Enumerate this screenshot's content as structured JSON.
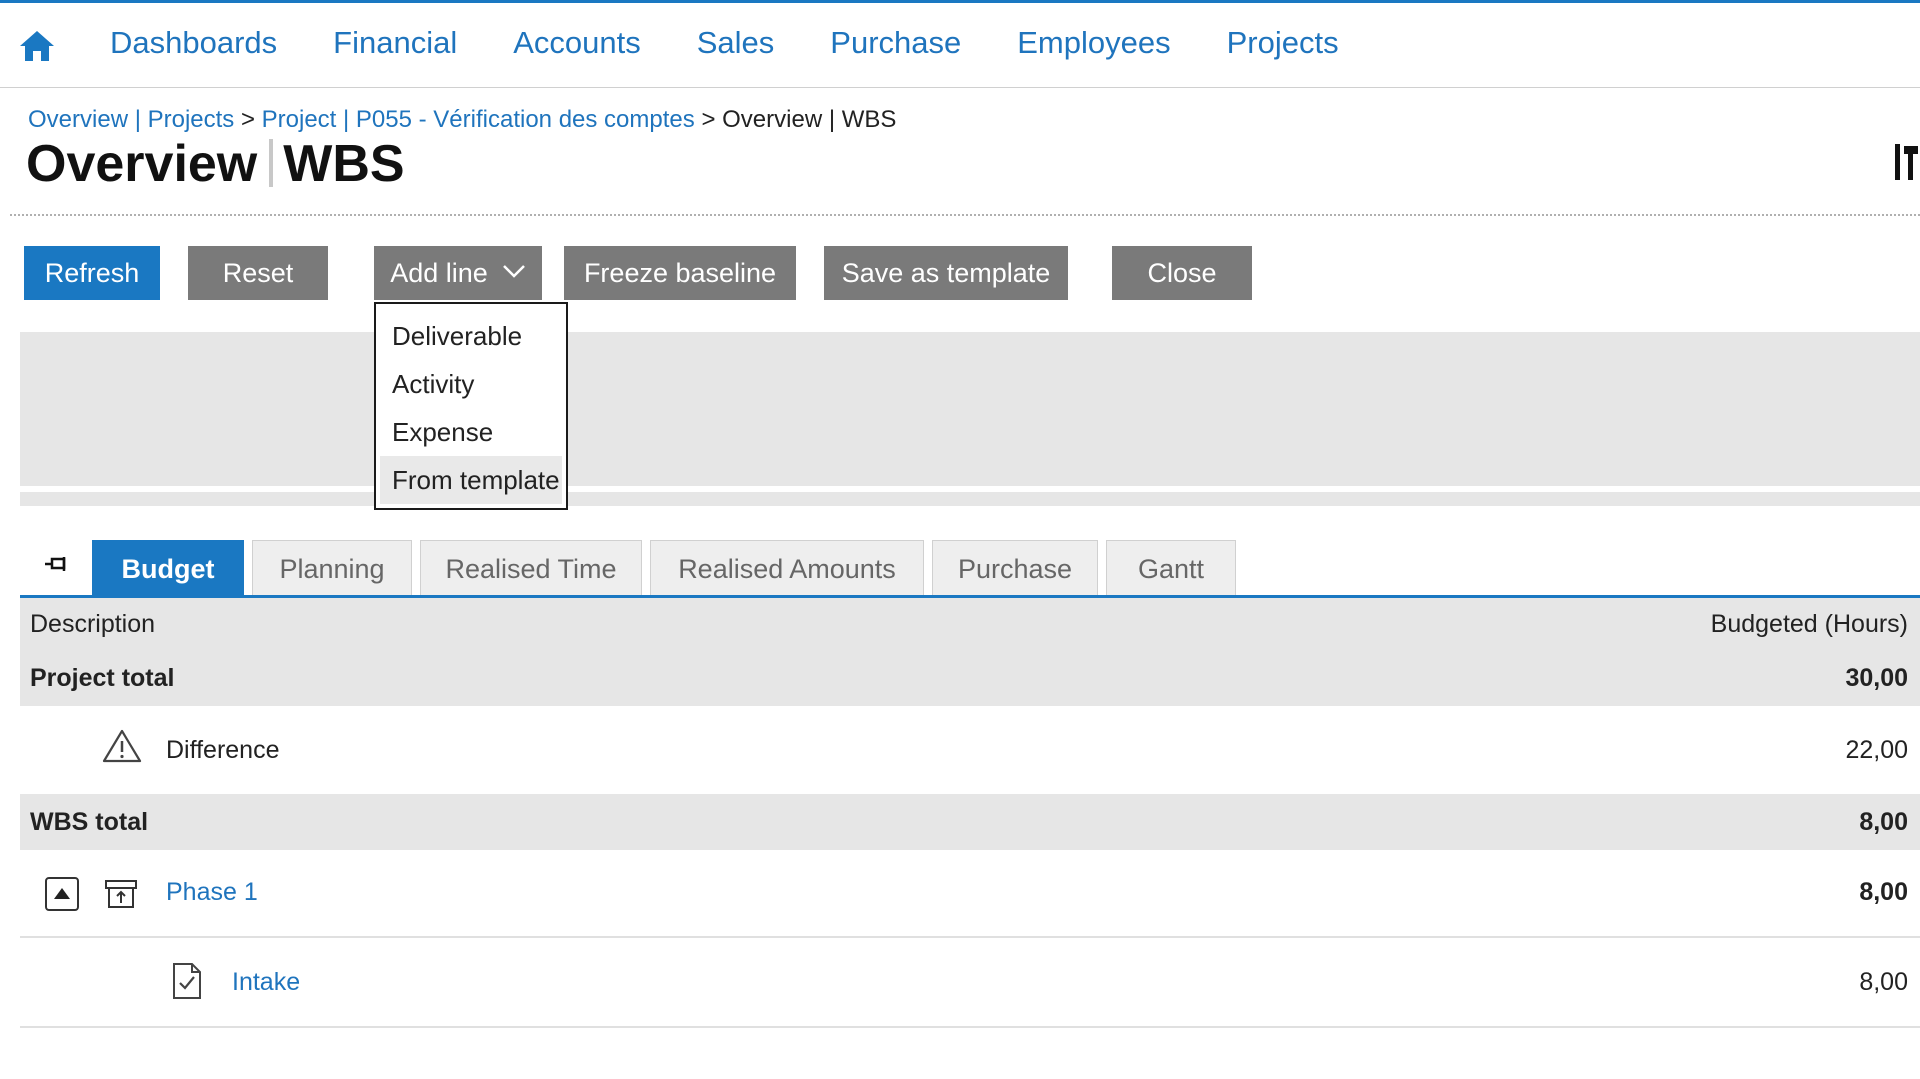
{
  "nav": {
    "home_icon": "home-icon",
    "items": [
      "Dashboards",
      "Financial",
      "Accounts",
      "Sales",
      "Purchase",
      "Employees",
      "Projects"
    ]
  },
  "breadcrumb": {
    "link1": "Overview | Projects",
    "sep1": ">",
    "link2": "Project | P055 - Vérification des comptes",
    "sep2": ">",
    "current": "Overview | WBS"
  },
  "page": {
    "title_left": "Overview",
    "title_right": "WBS",
    "tools_icon": "tools-icon"
  },
  "toolbar": {
    "refresh": "Refresh",
    "reset": "Reset",
    "add_line": "Add line",
    "freeze_baseline": "Freeze baseline",
    "save_as_template": "Save as template",
    "close": "Close"
  },
  "add_line_menu": {
    "items": [
      "Deliverable",
      "Activity",
      "Expense",
      "From template"
    ],
    "hovered": "From template"
  },
  "tabs": {
    "pin_icon": "pin-icon",
    "items": [
      "Budget",
      "Planning",
      "Realised Time",
      "Realised Amounts",
      "Purchase",
      "Gantt"
    ],
    "active": "Budget"
  },
  "grid": {
    "columns": {
      "description": "Description",
      "budgeted": "Budgeted (Hours)"
    },
    "project_total": {
      "label": "Project total",
      "value": "30,00"
    },
    "difference": {
      "label": "Difference",
      "value": "22,00",
      "icon": "warning-icon"
    },
    "wbs_total": {
      "label": "WBS total",
      "value": "8,00"
    },
    "phase": {
      "label": "Phase 1",
      "value": "8,00",
      "icon": "deliverable-box-icon",
      "toggle_icon": "collapse-up-icon"
    },
    "task": {
      "label": "Intake",
      "value": "8,00",
      "icon": "activity-document-check-icon"
    }
  },
  "colors": {
    "accent": "#1a78c2",
    "link": "#1f74bd",
    "button_gray": "#7a7a7a",
    "panel_gray": "#e6e6e6"
  }
}
